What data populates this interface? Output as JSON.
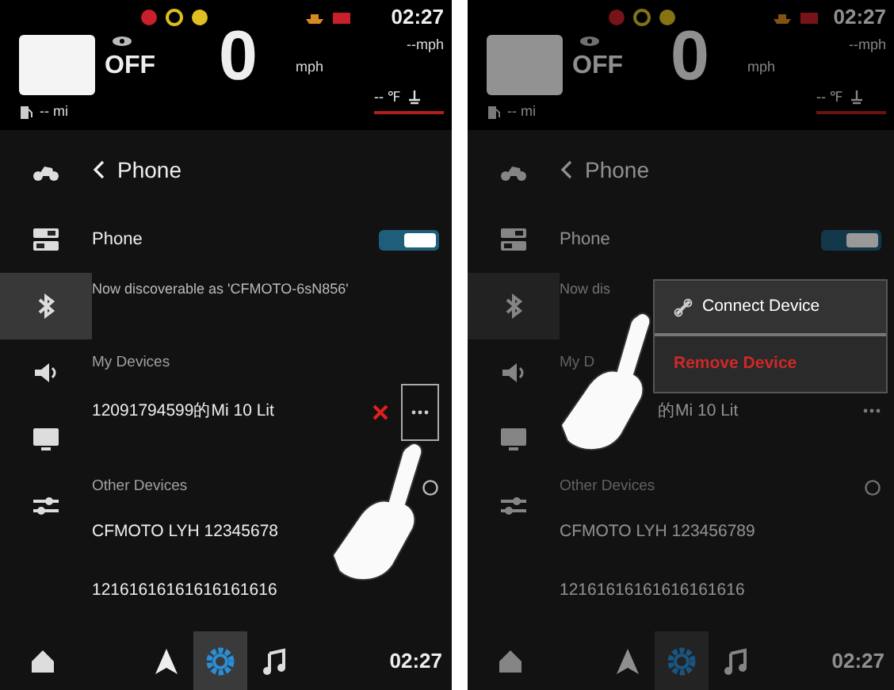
{
  "screens": [
    {
      "dimmed": false,
      "status": {
        "time": "02:27",
        "avg_speed": "--mph",
        "gear": "OFF",
        "speed": "0",
        "speed_unit": "mph",
        "range": "-- mi",
        "temperature": "-- ℉"
      },
      "title": "Phone",
      "sidebar": [
        {
          "selected": false
        },
        {
          "selected": false
        },
        {
          "selected": true
        },
        {
          "selected": false
        },
        {
          "selected": false
        },
        {
          "selected": false
        }
      ],
      "phone_toggle": {
        "label": "Phone",
        "on": true
      },
      "discoverable": "Now discoverable as 'CFMOTO-6sN856'",
      "my_devices": {
        "heading": "My Devices",
        "items": [
          {
            "name": "12091794599的Mi 10 Lit",
            "actions_shown": true
          }
        ]
      },
      "other_devices": {
        "heading": "Other Devices",
        "items": [
          {
            "name": "CFMOTO LYH 12345678"
          },
          {
            "name": "12161616161616161616"
          }
        ]
      },
      "bottom_nav": [
        {
          "selected": false
        },
        {
          "selected": false
        },
        {
          "selected": true
        },
        {
          "selected": false
        }
      ],
      "bottom_time": "02:27"
    },
    {
      "dimmed": true,
      "status": {
        "time": "02:27",
        "avg_speed": "--mph",
        "gear": "OFF",
        "speed": "0",
        "speed_unit": "mph",
        "range": "-- mi",
        "temperature": "-- ℉"
      },
      "title": "Phone",
      "sidebar": [
        {
          "selected": false
        },
        {
          "selected": false
        },
        {
          "selected": true
        },
        {
          "selected": false
        },
        {
          "selected": false
        },
        {
          "selected": false
        }
      ],
      "phone_toggle": {
        "label": "Phone",
        "on": true
      },
      "discoverable": "Now dis",
      "my_devices": {
        "heading": "My D",
        "items": [
          {
            "name": "的Mi 10 Lit",
            "actions_shown": false
          }
        ]
      },
      "other_devices": {
        "heading": "Other Devices",
        "items": [
          {
            "name": "CFMOTO LYH 123456789"
          },
          {
            "name": "12161616161616161616"
          }
        ]
      },
      "bottom_nav": [
        {
          "selected": false
        },
        {
          "selected": false
        },
        {
          "selected": true
        },
        {
          "selected": false
        }
      ],
      "bottom_time": "02:27",
      "popup": {
        "items": [
          {
            "label": "Connect Device",
            "kind": "connect"
          },
          {
            "label": "Remove Device",
            "kind": "remove"
          }
        ]
      }
    }
  ]
}
